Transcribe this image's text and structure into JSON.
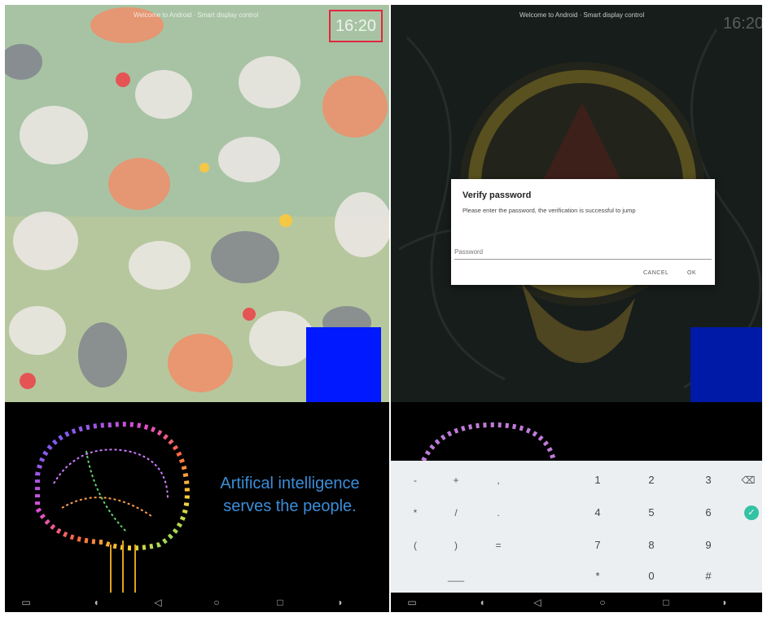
{
  "left_screen": {
    "status_text": "Welcome to Android · Smart display control",
    "time": "16:20",
    "accent_square_color": "#0019ff"
  },
  "right_screen": {
    "status_text": "Welcome to Android · Smart display control",
    "time": "16:20",
    "accent_square_color": "#001aa8",
    "dialog": {
      "title": "Verify password",
      "message": "Please enter the password, the verification is successful to jump",
      "input_placeholder": "Password",
      "cancel_label": "CANCEL",
      "ok_label": "OK"
    }
  },
  "brain_panel": {
    "caption_line1": "Artifical intelligence",
    "caption_line2": "serves the people."
  },
  "nav_icons": [
    "screenshot-icon",
    "volume-down-icon",
    "back-icon",
    "home-icon",
    "recents-icon",
    "volume-up-icon"
  ],
  "keyboard": {
    "rows": [
      [
        "-",
        "+",
        ",",
        "1",
        "2",
        "3",
        "⌫"
      ],
      [
        "*",
        "/",
        ".",
        "4",
        "5",
        "6",
        "✓"
      ],
      [
        "(",
        ")",
        "=",
        "7",
        "8",
        "9",
        ""
      ],
      [
        "",
        "___",
        "",
        "*",
        "0",
        "#",
        ""
      ]
    ],
    "enter_color": "#33c2a4"
  }
}
